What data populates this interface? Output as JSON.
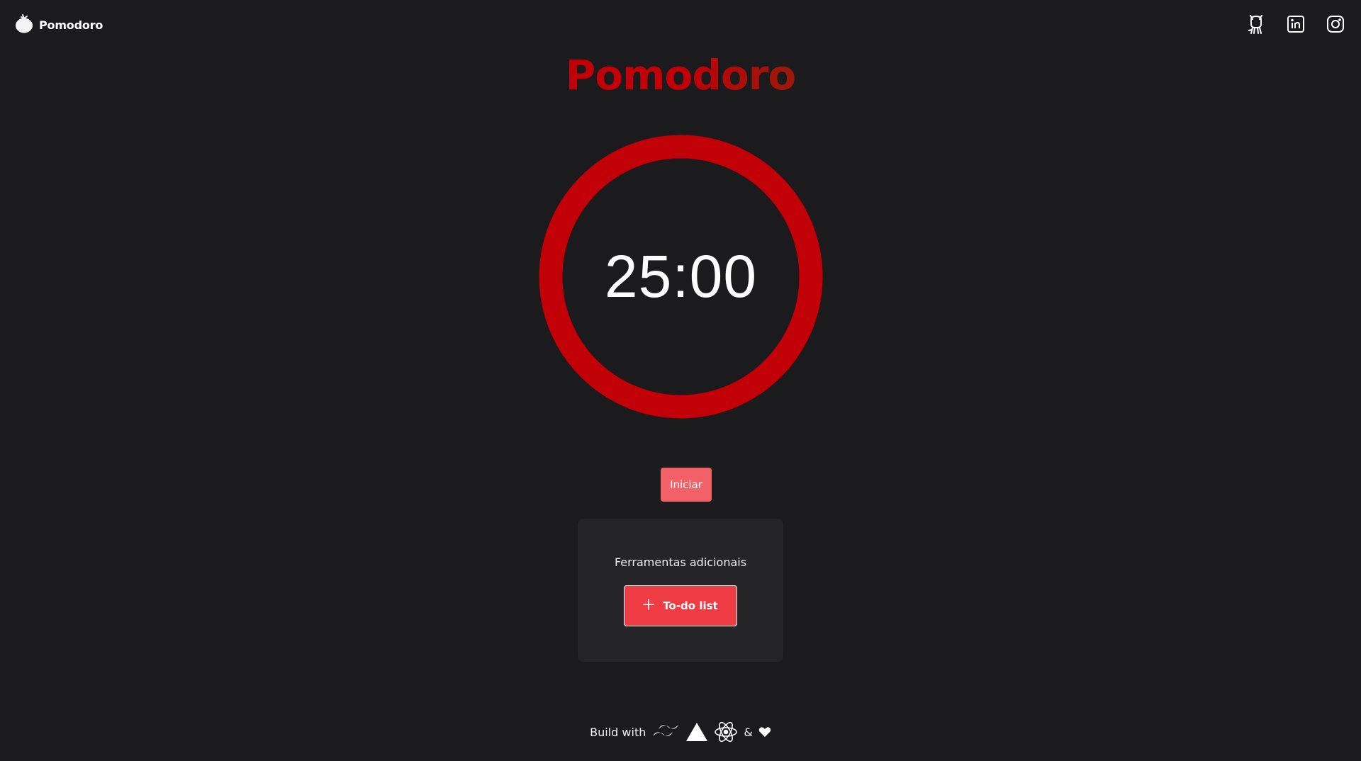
{
  "header": {
    "app_name": "Pomodoro",
    "logo_icon": "tomato-icon",
    "socials": [
      {
        "name": "github",
        "icon": "github-icon"
      },
      {
        "name": "linkedin",
        "icon": "linkedin-icon"
      },
      {
        "name": "instagram",
        "icon": "instagram-icon"
      }
    ]
  },
  "main": {
    "title": "Pomodoro",
    "timer": {
      "display": "25:00",
      "progress": 1.0
    },
    "start_label": "Iniciar"
  },
  "tools": {
    "heading": "Ferramentas adicionais",
    "todo_label": "To-do list",
    "todo_icon": "plus-icon"
  },
  "footer": {
    "prefix": "Build with",
    "tech_icons": [
      "tailwind-icon",
      "vite-icon",
      "react-icon"
    ],
    "amp": "&",
    "heart_icon": "heart-icon"
  },
  "colors": {
    "background": "#1b1b1d",
    "accent": "#c10008",
    "start_button": "#f16167",
    "todo_button": "#ef3b44",
    "card": "#252528"
  }
}
